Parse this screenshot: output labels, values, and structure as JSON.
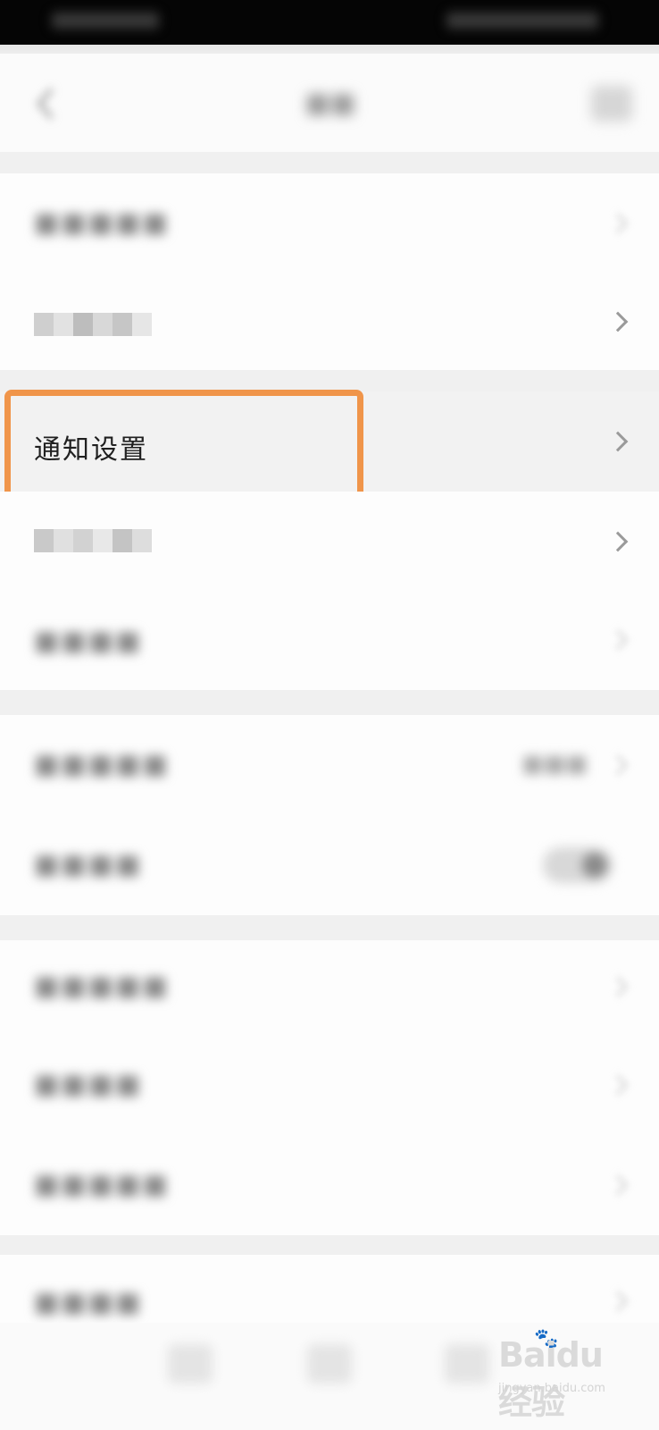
{
  "status_bar": {},
  "nav": {
    "back_icon": "chevron-left-icon",
    "more_icon": "more-icon"
  },
  "rows": [
    {
      "id": "row-1",
      "label": "",
      "blurred": true
    },
    {
      "id": "row-2",
      "label": "",
      "blurred": true,
      "censored": true
    },
    {
      "id": "notification-settings",
      "label": "通知设置",
      "blurred": false,
      "highlighted": true
    },
    {
      "id": "row-4",
      "label": "",
      "blurred": true,
      "censored": true
    },
    {
      "id": "row-5",
      "label": "",
      "blurred": true
    },
    {
      "id": "row-6",
      "label": "",
      "blurred": true,
      "has_value": true
    },
    {
      "id": "row-7",
      "label": "",
      "blurred": true,
      "has_toggle": true
    },
    {
      "id": "row-8",
      "label": "",
      "blurred": true
    },
    {
      "id": "row-9",
      "label": "",
      "blurred": true
    },
    {
      "id": "row-10",
      "label": "",
      "blurred": true
    },
    {
      "id": "row-11",
      "label": "",
      "blurred": true
    }
  ],
  "highlight_color": "#f0954a",
  "watermark": {
    "logo_text": "Baidu经验",
    "sub_text": "jingyan.baidu.com"
  },
  "tabs": [
    {
      "id": "tab-1",
      "icon": "tab-icon"
    },
    {
      "id": "tab-2",
      "icon": "tab-icon"
    },
    {
      "id": "tab-3",
      "icon": "tab-icon"
    }
  ]
}
